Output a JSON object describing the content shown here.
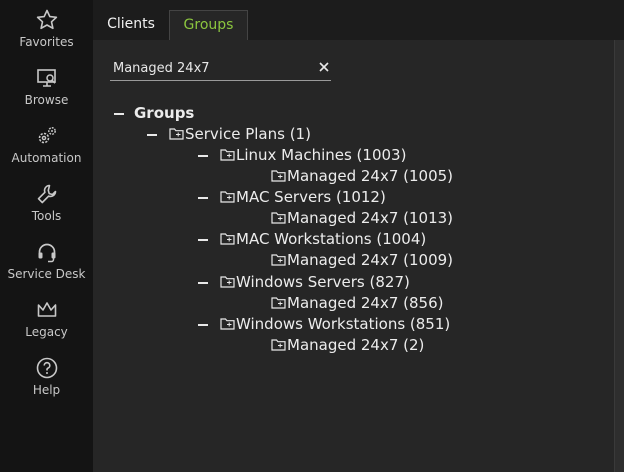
{
  "sidebar": {
    "items": [
      {
        "label": "Favorites",
        "icon": "star-icon"
      },
      {
        "label": "Browse",
        "icon": "monitor-search-icon"
      },
      {
        "label": "Automation",
        "icon": "gears-icon"
      },
      {
        "label": "Tools",
        "icon": "wrench-icon"
      },
      {
        "label": "Service Desk",
        "icon": "headset-icon"
      },
      {
        "label": "Legacy",
        "icon": "crown-icon"
      },
      {
        "label": "Help",
        "icon": "help-icon"
      }
    ]
  },
  "tabs": [
    {
      "label": "Clients",
      "active": false
    },
    {
      "label": "Groups",
      "active": true
    }
  ],
  "search": {
    "value": "Managed 24x7"
  },
  "tree": {
    "root": "Groups",
    "service_plans": "Service Plans (1)",
    "nodes": [
      {
        "label": "Linux Machines (1003)",
        "child": "Managed 24x7 (1005)"
      },
      {
        "label": "MAC Servers (1012)",
        "child": "Managed 24x7 (1013)"
      },
      {
        "label": "MAC Workstations (1004)",
        "child": "Managed 24x7 (1009)"
      },
      {
        "label": "Windows Servers (827)",
        "child": "Managed 24x7 (856)"
      },
      {
        "label": "Windows Workstations (851)",
        "child": "Managed 24x7 (2)"
      }
    ]
  },
  "colors": {
    "accent": "#8cc63f",
    "background": "#262626",
    "sidebar": "#141414"
  }
}
